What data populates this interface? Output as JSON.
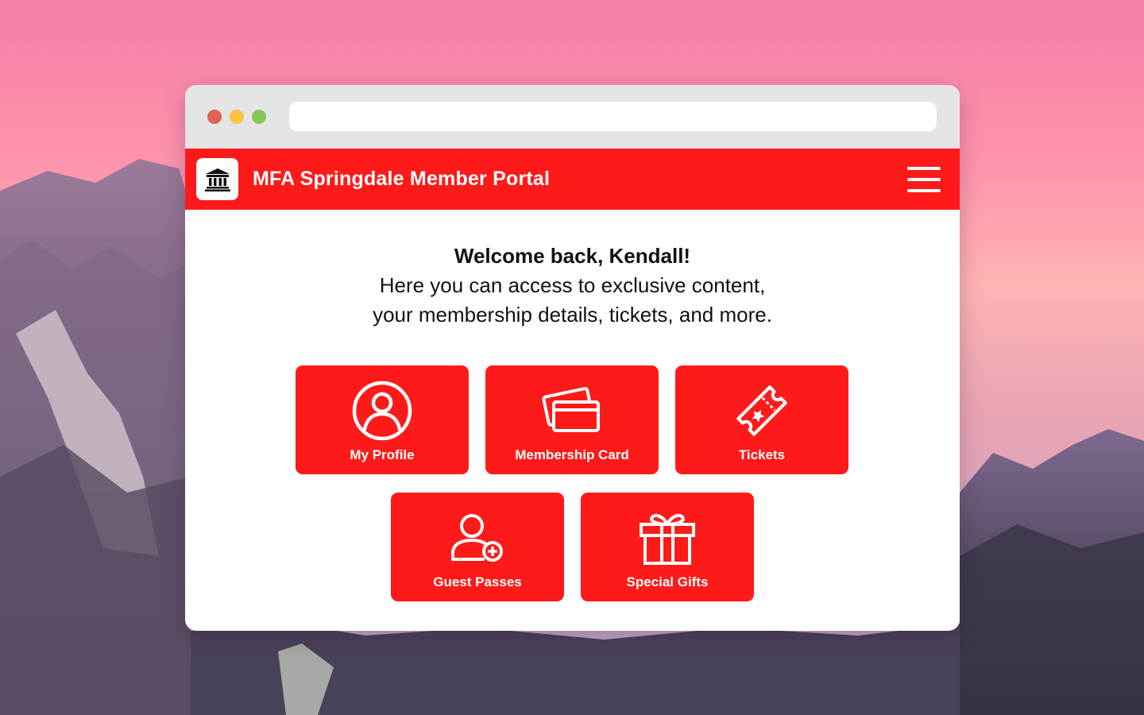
{
  "window": {
    "url": ""
  },
  "app": {
    "title": "MFA Springdale Member Portal",
    "logo_icon": "museum-icon",
    "menu_icon": "hamburger-menu-icon",
    "accent_color": "#ff1a1a"
  },
  "welcome": {
    "greeting": "Welcome back, Kendall!",
    "line1": "Here you can access to exclusive content,",
    "line2": "your membership details, tickets, and more."
  },
  "tiles": [
    {
      "label": "My Profile",
      "icon": "user-circle-icon"
    },
    {
      "label": "Membership Card",
      "icon": "cards-icon"
    },
    {
      "label": "Tickets",
      "icon": "ticket-icon"
    },
    {
      "label": "Guest Passes",
      "icon": "add-user-icon"
    },
    {
      "label": "Special Gifts",
      "icon": "gift-icon"
    }
  ]
}
